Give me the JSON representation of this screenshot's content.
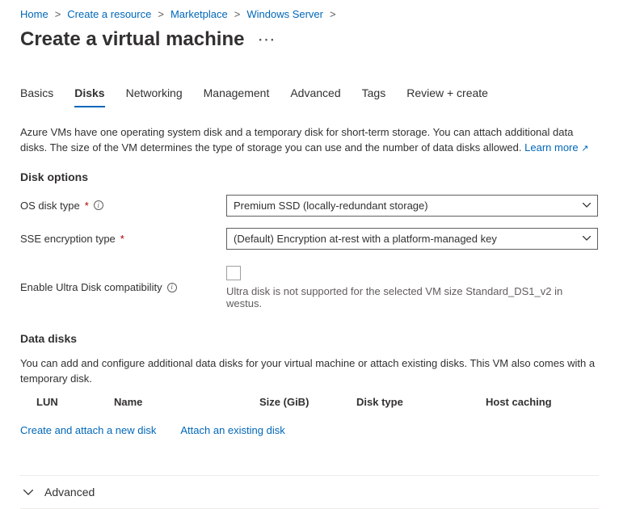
{
  "breadcrumb": {
    "items": [
      "Home",
      "Create a resource",
      "Marketplace",
      "Windows Server"
    ]
  },
  "page_title": "Create a virtual machine",
  "tabs": {
    "items": [
      "Basics",
      "Disks",
      "Networking",
      "Management",
      "Advanced",
      "Tags",
      "Review + create"
    ],
    "active_index": 1
  },
  "intro_text": "Azure VMs have one operating system disk and a temporary disk for short-term storage. You can attach additional data disks. The size of the VM determines the type of storage you can use and the number of data disks allowed.",
  "learn_more_label": "Learn more",
  "disk_options": {
    "heading": "Disk options",
    "os_disk_type_label": "OS disk type",
    "os_disk_type_value": "Premium SSD (locally-redundant storage)",
    "sse_label": "SSE encryption type",
    "sse_value": "(Default) Encryption at-rest with a platform-managed key",
    "ultra_label": "Enable Ultra Disk compatibility",
    "ultra_hint": "Ultra disk is not supported for the selected VM size Standard_DS1_v2 in westus."
  },
  "data_disks": {
    "heading": "Data disks",
    "desc": "You can add and configure additional data disks for your virtual machine or attach existing disks. This VM also comes with a temporary disk.",
    "columns": {
      "lun": "LUN",
      "name": "Name",
      "size": "Size (GiB)",
      "disk_type": "Disk type",
      "host_caching": "Host caching"
    },
    "create_label": "Create and attach a new disk",
    "attach_label": "Attach an existing disk"
  },
  "advanced_label": "Advanced"
}
